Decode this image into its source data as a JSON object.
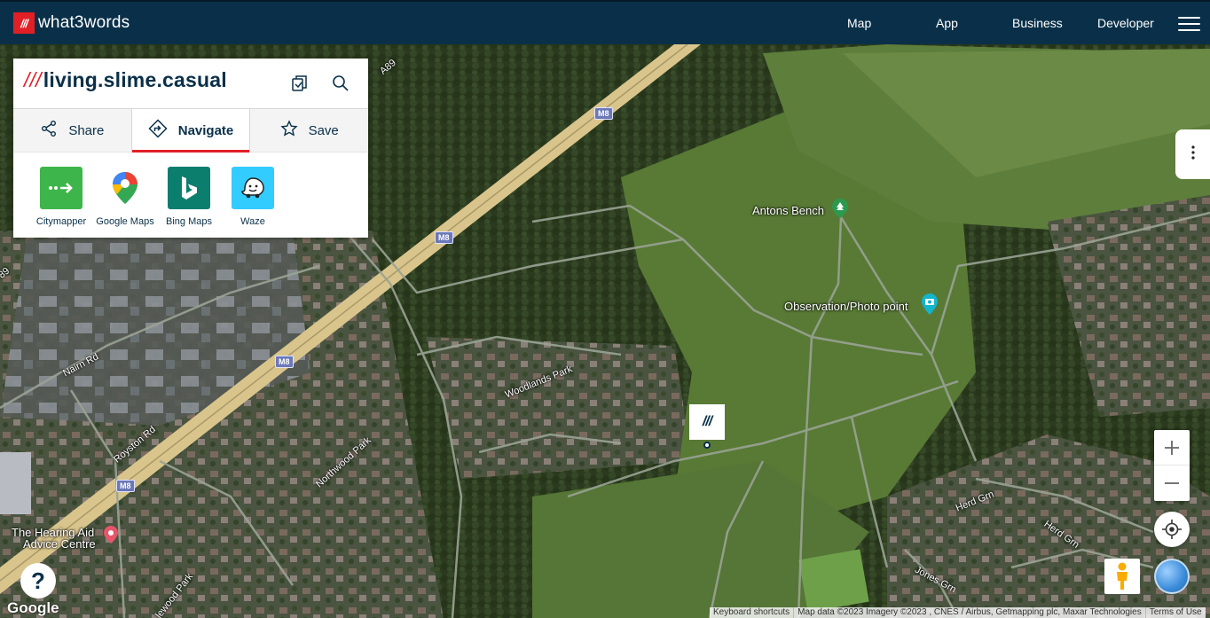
{
  "header": {
    "logo_mark": "///",
    "logo_text": "what3words",
    "nav": [
      "Map",
      "App",
      "Business",
      "Developer"
    ]
  },
  "address": {
    "prefix": "///",
    "words": "living.slime.casual"
  },
  "tabs": [
    {
      "label": "Share",
      "icon": "share-icon",
      "active": false
    },
    {
      "label": "Navigate",
      "icon": "navigate-icon",
      "active": true
    },
    {
      "label": "Save",
      "icon": "star-icon",
      "active": false
    }
  ],
  "apps": [
    {
      "label": "Citymapper",
      "color": "#3eb54a",
      "icon": "citymapper-icon"
    },
    {
      "label": "Google Maps",
      "color": "#ffffff",
      "icon": "google-maps-icon"
    },
    {
      "label": "Bing Maps",
      "color": "#0c7e6e",
      "icon": "bing-icon"
    },
    {
      "label": "Waze",
      "color": "#33ccff",
      "icon": "waze-icon"
    }
  ],
  "map": {
    "labels": {
      "antons_bench": "Antons Bench",
      "observation": "Observation/Photo point",
      "hearing_aid_1": "The Hearing Aid",
      "hearing_aid_2": "Advice Centre",
      "woodlands": "Woodlands Park",
      "northwood": "Northwood Park",
      "royston": "Royston Rd",
      "nairn": "Nairn Rd",
      "herd1": "Herd Grn",
      "herd2": "Herd Grn",
      "jones": "Jones Grn",
      "glenwood": "lewood Park",
      "a89_top": "A89",
      "a89_left": "89",
      "m8": "M8"
    },
    "marker": "///",
    "google": "Google",
    "help": "?"
  },
  "attribution": {
    "shortcuts": "Keyboard shortcuts",
    "data": "Map data ©2023 Imagery ©2023 , CNES / Airbus, Getmapping plc, Maxar Technologies",
    "terms": "Terms of Use"
  },
  "colors": {
    "brand_red": "#e11f26",
    "brand_navy": "#0a3049"
  }
}
